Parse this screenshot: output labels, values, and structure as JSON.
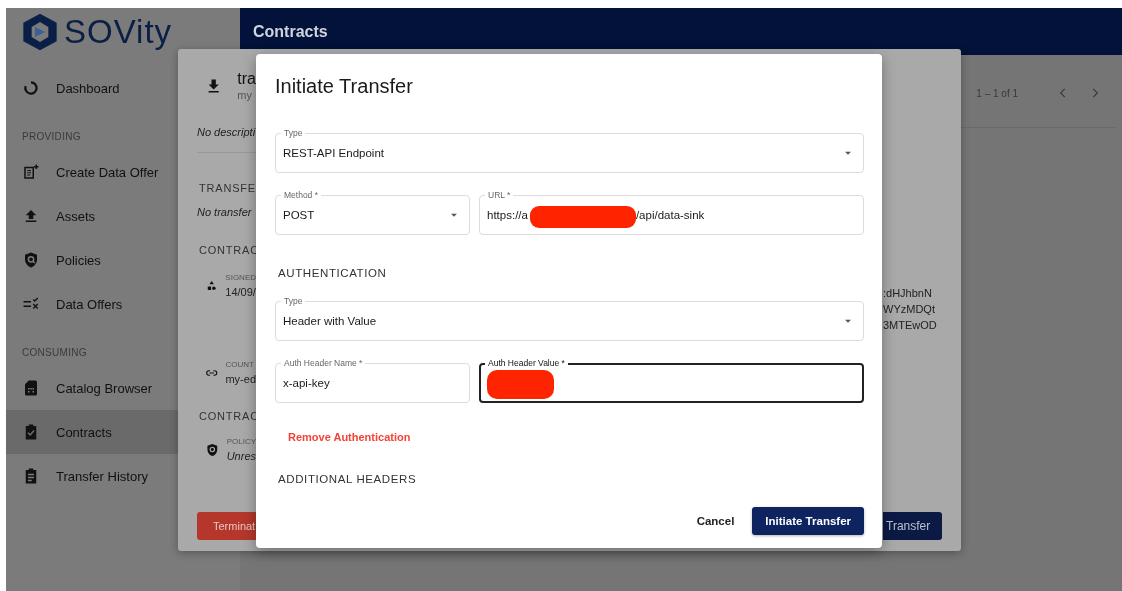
{
  "logo": {
    "text": "SOVity"
  },
  "sidebar": {
    "sections": [
      {
        "items": [
          {
            "label": "Dashboard",
            "selected": false
          }
        ]
      },
      {
        "heading": "PROVIDING",
        "items": [
          {
            "label": "Create Data Offer",
            "selected": false
          },
          {
            "label": "Assets",
            "selected": false
          },
          {
            "label": "Policies",
            "selected": false
          },
          {
            "label": "Data Offers",
            "selected": false
          }
        ]
      },
      {
        "heading": "CONSUMING",
        "items": [
          {
            "label": "Catalog Browser",
            "selected": false
          },
          {
            "label": "Contracts",
            "selected": true
          },
          {
            "label": "Transfer History",
            "selected": false
          }
        ]
      }
    ]
  },
  "header": {
    "title": "Contracts"
  },
  "pagination": {
    "range": "1 – 1 of 1"
  },
  "detail": {
    "title": "tra",
    "subtitle": "my",
    "description": "No descripti",
    "transfers_heading": "TRANSFE",
    "transfers_empty": "No transfer",
    "contract_heading": "CONTRAC",
    "signed": {
      "label": "SIGNED",
      "value": "14/09/"
    },
    "id_fragments": [
      ":dHJhbnN",
      "WYzMDQt",
      "3MTEwOD"
    ],
    "counterparty": {
      "label": "COUNT",
      "value": "my-ed"
    },
    "policy_heading": "CONTRAC",
    "policy": {
      "label": "POLICY",
      "value": "Unres"
    },
    "terminate_button": "Terminat",
    "transfer_button": "Transfer"
  },
  "dialog": {
    "title": "Initiate Transfer",
    "content": [
      {
        "kind": "row",
        "fields": [
          {
            "label": "Type",
            "value": "REST-API Endpoint",
            "dropdown": true,
            "focused": false,
            "redacted": false
          }
        ]
      },
      {
        "kind": "row",
        "fields": [
          {
            "label": "Method *",
            "value": "POST",
            "dropdown": true,
            "focused": false,
            "redacted": false
          },
          {
            "label": "URL *",
            "value": "https://a",
            "value_after": "/api/data-sink",
            "dropdown": false,
            "focused": false,
            "redacted": true
          }
        ]
      },
      {
        "kind": "heading",
        "text": "AUTHENTICATION"
      },
      {
        "kind": "row",
        "fields": [
          {
            "label": "Type",
            "value": "Header with Value",
            "dropdown": true,
            "focused": false,
            "redacted": false
          }
        ]
      },
      {
        "kind": "row",
        "fields": [
          {
            "label": "Auth Header Name *",
            "value": "x-api-key",
            "dropdown": false,
            "focused": false,
            "redacted": false
          },
          {
            "label": "Auth Header Value *",
            "dropdown": false,
            "focused": true,
            "redacted": true
          }
        ]
      },
      {
        "kind": "text-button",
        "text": "Remove Authentication"
      },
      {
        "kind": "heading",
        "text": "ADDITIONAL HEADERS"
      }
    ],
    "buttons": [
      {
        "label": "Cancel",
        "primary": false
      },
      {
        "label": "Initiate Transfer",
        "primary": true
      }
    ]
  }
}
